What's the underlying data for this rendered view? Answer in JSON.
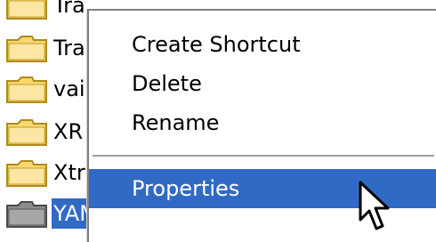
{
  "tree": {
    "items": [
      {
        "label": "Tra",
        "selected": false
      },
      {
        "label": "Tra",
        "selected": false
      },
      {
        "label": "vai",
        "selected": false
      },
      {
        "label": "XR",
        "selected": false
      },
      {
        "label": "Xtr",
        "selected": false
      },
      {
        "label": "YAMJ",
        "selected": true
      }
    ]
  },
  "context_menu": {
    "items": [
      {
        "label": "Create Shortcut"
      },
      {
        "label": "Delete"
      },
      {
        "label": "Rename"
      },
      {
        "label": "Properties",
        "highlighted": true
      }
    ]
  },
  "colors": {
    "selection": "#316ac5",
    "folder_yellow": "#f6d86e",
    "folder_gray": "#8c8c8c"
  },
  "icons": {
    "folder": "folder-icon",
    "cursor": "mouse-pointer-icon"
  }
}
